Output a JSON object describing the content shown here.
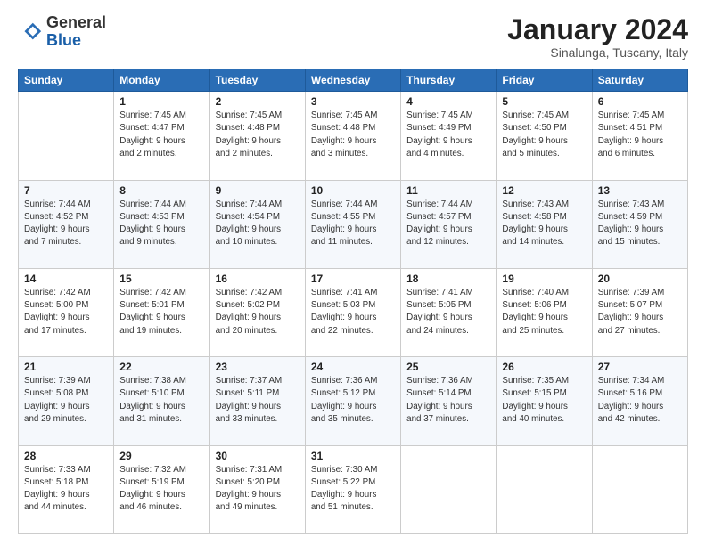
{
  "header": {
    "logo_general": "General",
    "logo_blue": "Blue",
    "month_title": "January 2024",
    "subtitle": "Sinalunga, Tuscany, Italy"
  },
  "weekdays": [
    "Sunday",
    "Monday",
    "Tuesday",
    "Wednesday",
    "Thursday",
    "Friday",
    "Saturday"
  ],
  "weeks": [
    [
      {
        "day": "",
        "info": ""
      },
      {
        "day": "1",
        "info": "Sunrise: 7:45 AM\nSunset: 4:47 PM\nDaylight: 9 hours\nand 2 minutes."
      },
      {
        "day": "2",
        "info": "Sunrise: 7:45 AM\nSunset: 4:48 PM\nDaylight: 9 hours\nand 2 minutes."
      },
      {
        "day": "3",
        "info": "Sunrise: 7:45 AM\nSunset: 4:48 PM\nDaylight: 9 hours\nand 3 minutes."
      },
      {
        "day": "4",
        "info": "Sunrise: 7:45 AM\nSunset: 4:49 PM\nDaylight: 9 hours\nand 4 minutes."
      },
      {
        "day": "5",
        "info": "Sunrise: 7:45 AM\nSunset: 4:50 PM\nDaylight: 9 hours\nand 5 minutes."
      },
      {
        "day": "6",
        "info": "Sunrise: 7:45 AM\nSunset: 4:51 PM\nDaylight: 9 hours\nand 6 minutes."
      }
    ],
    [
      {
        "day": "7",
        "info": "Sunrise: 7:44 AM\nSunset: 4:52 PM\nDaylight: 9 hours\nand 7 minutes."
      },
      {
        "day": "8",
        "info": "Sunrise: 7:44 AM\nSunset: 4:53 PM\nDaylight: 9 hours\nand 9 minutes."
      },
      {
        "day": "9",
        "info": "Sunrise: 7:44 AM\nSunset: 4:54 PM\nDaylight: 9 hours\nand 10 minutes."
      },
      {
        "day": "10",
        "info": "Sunrise: 7:44 AM\nSunset: 4:55 PM\nDaylight: 9 hours\nand 11 minutes."
      },
      {
        "day": "11",
        "info": "Sunrise: 7:44 AM\nSunset: 4:57 PM\nDaylight: 9 hours\nand 12 minutes."
      },
      {
        "day": "12",
        "info": "Sunrise: 7:43 AM\nSunset: 4:58 PM\nDaylight: 9 hours\nand 14 minutes."
      },
      {
        "day": "13",
        "info": "Sunrise: 7:43 AM\nSunset: 4:59 PM\nDaylight: 9 hours\nand 15 minutes."
      }
    ],
    [
      {
        "day": "14",
        "info": "Sunrise: 7:42 AM\nSunset: 5:00 PM\nDaylight: 9 hours\nand 17 minutes."
      },
      {
        "day": "15",
        "info": "Sunrise: 7:42 AM\nSunset: 5:01 PM\nDaylight: 9 hours\nand 19 minutes."
      },
      {
        "day": "16",
        "info": "Sunrise: 7:42 AM\nSunset: 5:02 PM\nDaylight: 9 hours\nand 20 minutes."
      },
      {
        "day": "17",
        "info": "Sunrise: 7:41 AM\nSunset: 5:03 PM\nDaylight: 9 hours\nand 22 minutes."
      },
      {
        "day": "18",
        "info": "Sunrise: 7:41 AM\nSunset: 5:05 PM\nDaylight: 9 hours\nand 24 minutes."
      },
      {
        "day": "19",
        "info": "Sunrise: 7:40 AM\nSunset: 5:06 PM\nDaylight: 9 hours\nand 25 minutes."
      },
      {
        "day": "20",
        "info": "Sunrise: 7:39 AM\nSunset: 5:07 PM\nDaylight: 9 hours\nand 27 minutes."
      }
    ],
    [
      {
        "day": "21",
        "info": "Sunrise: 7:39 AM\nSunset: 5:08 PM\nDaylight: 9 hours\nand 29 minutes."
      },
      {
        "day": "22",
        "info": "Sunrise: 7:38 AM\nSunset: 5:10 PM\nDaylight: 9 hours\nand 31 minutes."
      },
      {
        "day": "23",
        "info": "Sunrise: 7:37 AM\nSunset: 5:11 PM\nDaylight: 9 hours\nand 33 minutes."
      },
      {
        "day": "24",
        "info": "Sunrise: 7:36 AM\nSunset: 5:12 PM\nDaylight: 9 hours\nand 35 minutes."
      },
      {
        "day": "25",
        "info": "Sunrise: 7:36 AM\nSunset: 5:14 PM\nDaylight: 9 hours\nand 37 minutes."
      },
      {
        "day": "26",
        "info": "Sunrise: 7:35 AM\nSunset: 5:15 PM\nDaylight: 9 hours\nand 40 minutes."
      },
      {
        "day": "27",
        "info": "Sunrise: 7:34 AM\nSunset: 5:16 PM\nDaylight: 9 hours\nand 42 minutes."
      }
    ],
    [
      {
        "day": "28",
        "info": "Sunrise: 7:33 AM\nSunset: 5:18 PM\nDaylight: 9 hours\nand 44 minutes."
      },
      {
        "day": "29",
        "info": "Sunrise: 7:32 AM\nSunset: 5:19 PM\nDaylight: 9 hours\nand 46 minutes."
      },
      {
        "day": "30",
        "info": "Sunrise: 7:31 AM\nSunset: 5:20 PM\nDaylight: 9 hours\nand 49 minutes."
      },
      {
        "day": "31",
        "info": "Sunrise: 7:30 AM\nSunset: 5:22 PM\nDaylight: 9 hours\nand 51 minutes."
      },
      {
        "day": "",
        "info": ""
      },
      {
        "day": "",
        "info": ""
      },
      {
        "day": "",
        "info": ""
      }
    ]
  ]
}
